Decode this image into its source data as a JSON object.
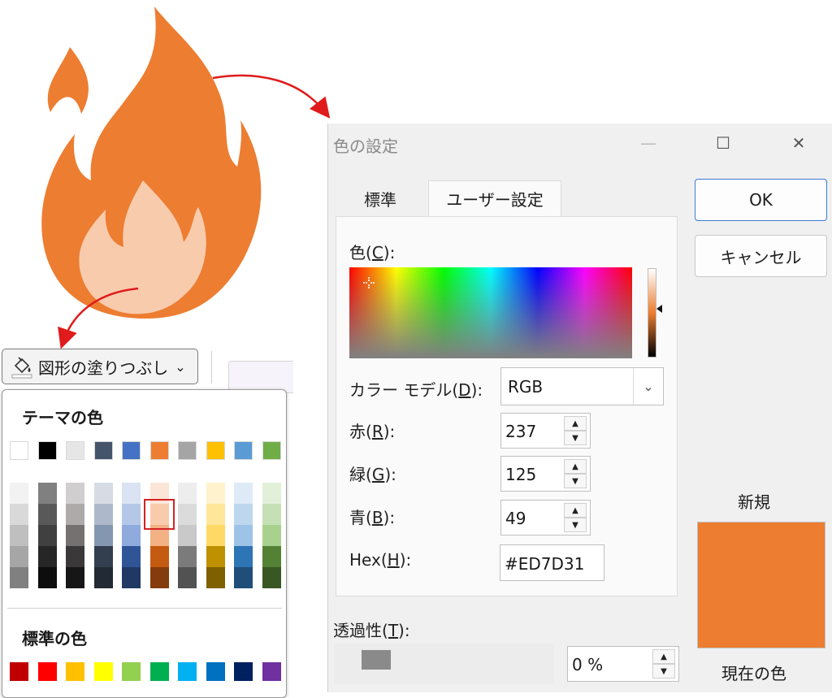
{
  "palette": {
    "theme_heading": "テーマの色",
    "standard_heading": "標準の色",
    "theme_top": [
      "#ffffff",
      "#000000",
      "#e7e6e6",
      "#44546a",
      "#4472c4",
      "#ed7d31",
      "#a5a5a5",
      "#ffc000",
      "#5b9bd5",
      "#70ad47"
    ],
    "theme_shades": [
      [
        "#f2f2f2",
        "#d9d9d9",
        "#bfbfbf",
        "#a6a6a6",
        "#808080"
      ],
      [
        "#808080",
        "#595959",
        "#404040",
        "#262626",
        "#0d0d0d"
      ],
      [
        "#d0cece",
        "#aeaaaa",
        "#757171",
        "#3a3838",
        "#171616"
      ],
      [
        "#d6dce4",
        "#adb9ca",
        "#8497b0",
        "#333f4f",
        "#222a35"
      ],
      [
        "#dae3f3",
        "#b4c7e7",
        "#8faadc",
        "#2f5597",
        "#203864"
      ],
      [
        "#fbe5d6",
        "#f8cbad",
        "#f4b183",
        "#c55a11",
        "#843c0c"
      ],
      [
        "#ededed",
        "#dbdbdb",
        "#c9c9c9",
        "#7b7b7b",
        "#525252"
      ],
      [
        "#fff2cc",
        "#ffe699",
        "#ffd966",
        "#bf9000",
        "#7f6000"
      ],
      [
        "#deebf7",
        "#bdd7ee",
        "#9dc3e6",
        "#2e75b6",
        "#1f4e79"
      ],
      [
        "#e2f0d9",
        "#c5e0b4",
        "#a9d18e",
        "#548235",
        "#385723"
      ]
    ],
    "standard": [
      "#c00000",
      "#ff0000",
      "#ffc000",
      "#ffff00",
      "#92d050",
      "#00b050",
      "#00b0f0",
      "#0070c0",
      "#002060",
      "#7030a0"
    ]
  },
  "fill_button": {
    "label": "図形の塗りつぶし",
    "chevron": "⌄",
    "icon": "paint-bucket-icon"
  },
  "dialog": {
    "title": "色の設定",
    "minimize": "—",
    "maximize": "☐",
    "close": "✕",
    "tabs": [
      "標準",
      "ユーザー設定"
    ],
    "active_tab": "ユーザー設定",
    "color_label_pre": "色(",
    "color_label_key": "C",
    "color_label_post": "):",
    "model_label_pre": "カラー モデル(",
    "model_label_key": "D",
    "model_label_post": "):",
    "model_value": "RGB",
    "red_pre": "赤(",
    "red_key": "R",
    "red_post": "):",
    "red_value": "237",
    "green_pre": "緑(",
    "green_key": "G",
    "green_post": "):",
    "green_value": "125",
    "blue_pre": "青(",
    "blue_key": "B",
    "blue_post": "):",
    "blue_value": "49",
    "hex_pre": "Hex(",
    "hex_key": "H",
    "hex_post": "):",
    "hex_value": "#ED7D31",
    "transparency_pre": "透過性(",
    "transparency_key": "T",
    "transparency_post": "):",
    "transparency_value": "0 %",
    "transparency_level": 0,
    "ok": "OK",
    "cancel": "キャンセル",
    "new_label": "新規",
    "current_label": "現在の色",
    "current_color": "#ed7d31",
    "spin_up": "▲",
    "spin_down": "▼",
    "dropdown_chevron": "⌄"
  },
  "flame_colors": {
    "outer": "#ed7d31",
    "inner": "#f8cbad"
  },
  "arrow_color": "#e01b1b"
}
